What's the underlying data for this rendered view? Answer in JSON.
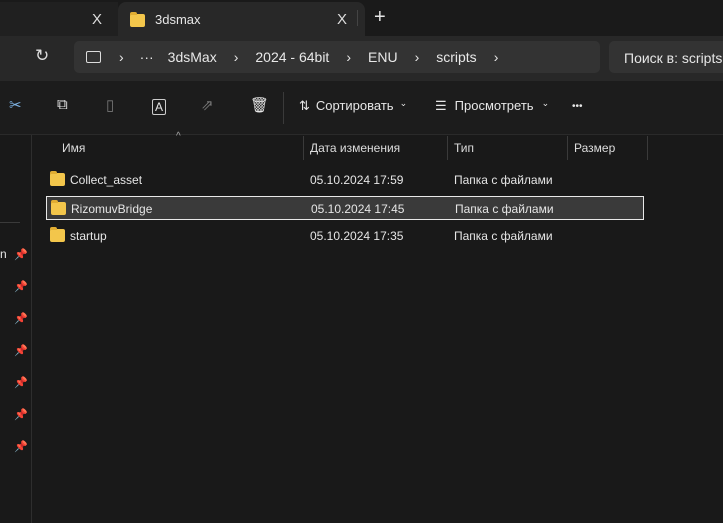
{
  "tabs": [
    {
      "label": "",
      "close": "X"
    },
    {
      "label": "3dsmax",
      "close": "X"
    }
  ],
  "new_tab": "+",
  "address": {
    "ellipsis": "···",
    "crumbs": [
      "3dsMax",
      "2024 - 64bit",
      "ENU",
      "scripts"
    ],
    "sep": "›"
  },
  "search_placeholder": "Поиск в: scripts",
  "toolbar": {
    "sort": "Сортировать",
    "view": "Просмотреть",
    "more": "•••",
    "chev": "⌄"
  },
  "columns": {
    "name": "Имя",
    "date": "Дата изменения",
    "type": "Тип",
    "size": "Размер"
  },
  "files": [
    {
      "name": "Collect_asset",
      "date": "05.10.2024 17:59",
      "type": "Папка с файлами",
      "selected": false
    },
    {
      "name": "RizomuvBridge",
      "date": "05.10.2024 17:45",
      "type": "Папка с файлами",
      "selected": true
    },
    {
      "name": "startup",
      "date": "05.10.2024 17:35",
      "type": "Папка с файлами",
      "selected": false
    }
  ],
  "sidebar_partial": "n"
}
